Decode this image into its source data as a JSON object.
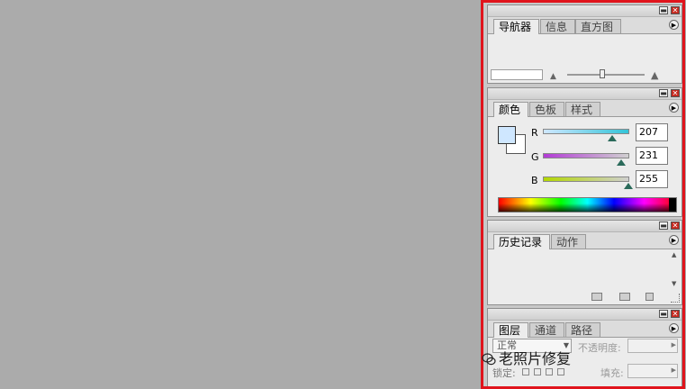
{
  "navigator_panel": {
    "tabs": [
      "导航器",
      "信息",
      "直方图"
    ],
    "minimize_glyph": "▬",
    "close_glyph": "✕",
    "menu_glyph": "▶",
    "zoom_out_glyph": "▲",
    "zoom_in_glyph": "▲",
    "zoom_level": 0.45
  },
  "color_panel": {
    "tabs": [
      "颜色",
      "色板",
      "样式"
    ],
    "minimize_glyph": "▬",
    "close_glyph": "✕",
    "menu_glyph": "▶",
    "foreground_color": "#cfe7ff",
    "background_color": "#ffffff",
    "channels": [
      {
        "label": "R",
        "value": "207",
        "fraction": 0.81,
        "track": "linear-gradient(to right,#cfe7ff,#33c4d8)"
      },
      {
        "label": "G",
        "value": "231",
        "fraction": 0.91,
        "track": "linear-gradient(to right,#b33bd6,#d0d0d0)"
      },
      {
        "label": "B",
        "value": "255",
        "fraction": 1.0,
        "track": "linear-gradient(to right,#b4d800,#d0d0d0)"
      }
    ]
  },
  "history_panel": {
    "tabs": [
      "历史记录",
      "动作"
    ],
    "minimize_glyph": "▬",
    "close_glyph": "✕",
    "menu_glyph": "▶",
    "scroll_up_glyph": "▲",
    "scroll_down_glyph": "▼"
  },
  "layers_panel": {
    "tabs": [
      "图层",
      "通道",
      "路径"
    ],
    "minimize_glyph": "▬",
    "close_glyph": "✕",
    "menu_glyph": "▶",
    "blend_mode": "正常",
    "opacity_label": "不透明度:",
    "lock_label": "锁定:",
    "fill_label": "填充:",
    "dropdown_glyph": "▼",
    "field_arrow_glyph": "▶"
  },
  "watermark": {
    "text": "老照片修复"
  },
  "colors": {
    "canvas": "#ababab",
    "dock_highlight": "#e0141c",
    "panel_bg": "#ececec"
  }
}
